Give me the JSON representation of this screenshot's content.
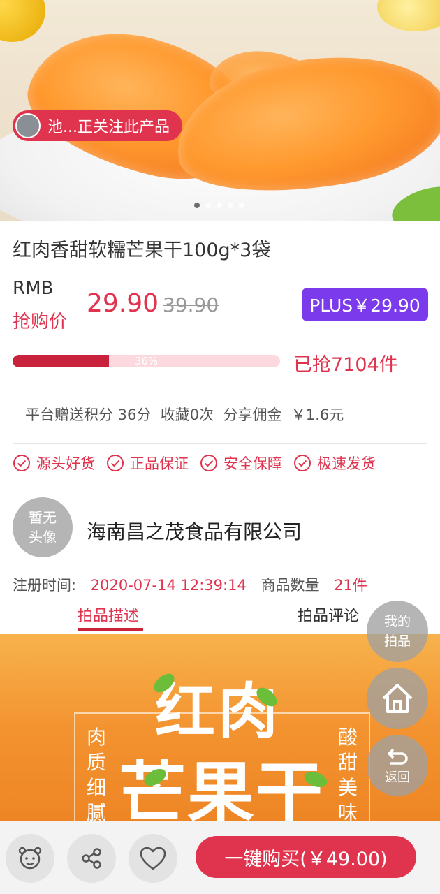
{
  "hero": {
    "follow_text": "池...正关注此产品",
    "dots_count": 5,
    "active_dot": 0
  },
  "product": {
    "title": "红肉香甜软糯芒果干100g*3袋",
    "currency_label": "RMB",
    "buy_label": "抢购价",
    "price": "29.90",
    "original_price": "39.90",
    "plus_price": "PLUS￥29.90",
    "progress_percent": 36,
    "progress_label": "36%",
    "sold_text": "已抢7104件",
    "info_line": "平台赠送积分 36分  收藏0次  分享佣金  ￥1.6元"
  },
  "features": [
    "源头好货",
    "正品保证",
    "安全保障",
    "极速发货"
  ],
  "shop": {
    "avatar_text_1": "暂无",
    "avatar_text_2": "头像",
    "name": "海南昌之茂食品有限公司",
    "reg_label": "注册时间:",
    "reg_time": "2020-07-14 12:39:14",
    "count_label": "商品数量",
    "count_value": "21件"
  },
  "tabs": {
    "description": "拍品描述",
    "reviews": "拍品评论"
  },
  "poster": {
    "title_line1": "红肉",
    "title_line2": "芒果干",
    "left_vertical": "肉质细腻",
    "right_vertical": "酸甜美味"
  },
  "floating": {
    "my_items_1": "我的",
    "my_items_2": "拍品",
    "back": "返回"
  },
  "bottom": {
    "buy_button": "一键购买(￥49.00)"
  },
  "colors": {
    "accent": "#e0334e",
    "plus": "#7c3aed",
    "progress_fill": "#c8223d",
    "progress_track": "#fcd9df"
  }
}
